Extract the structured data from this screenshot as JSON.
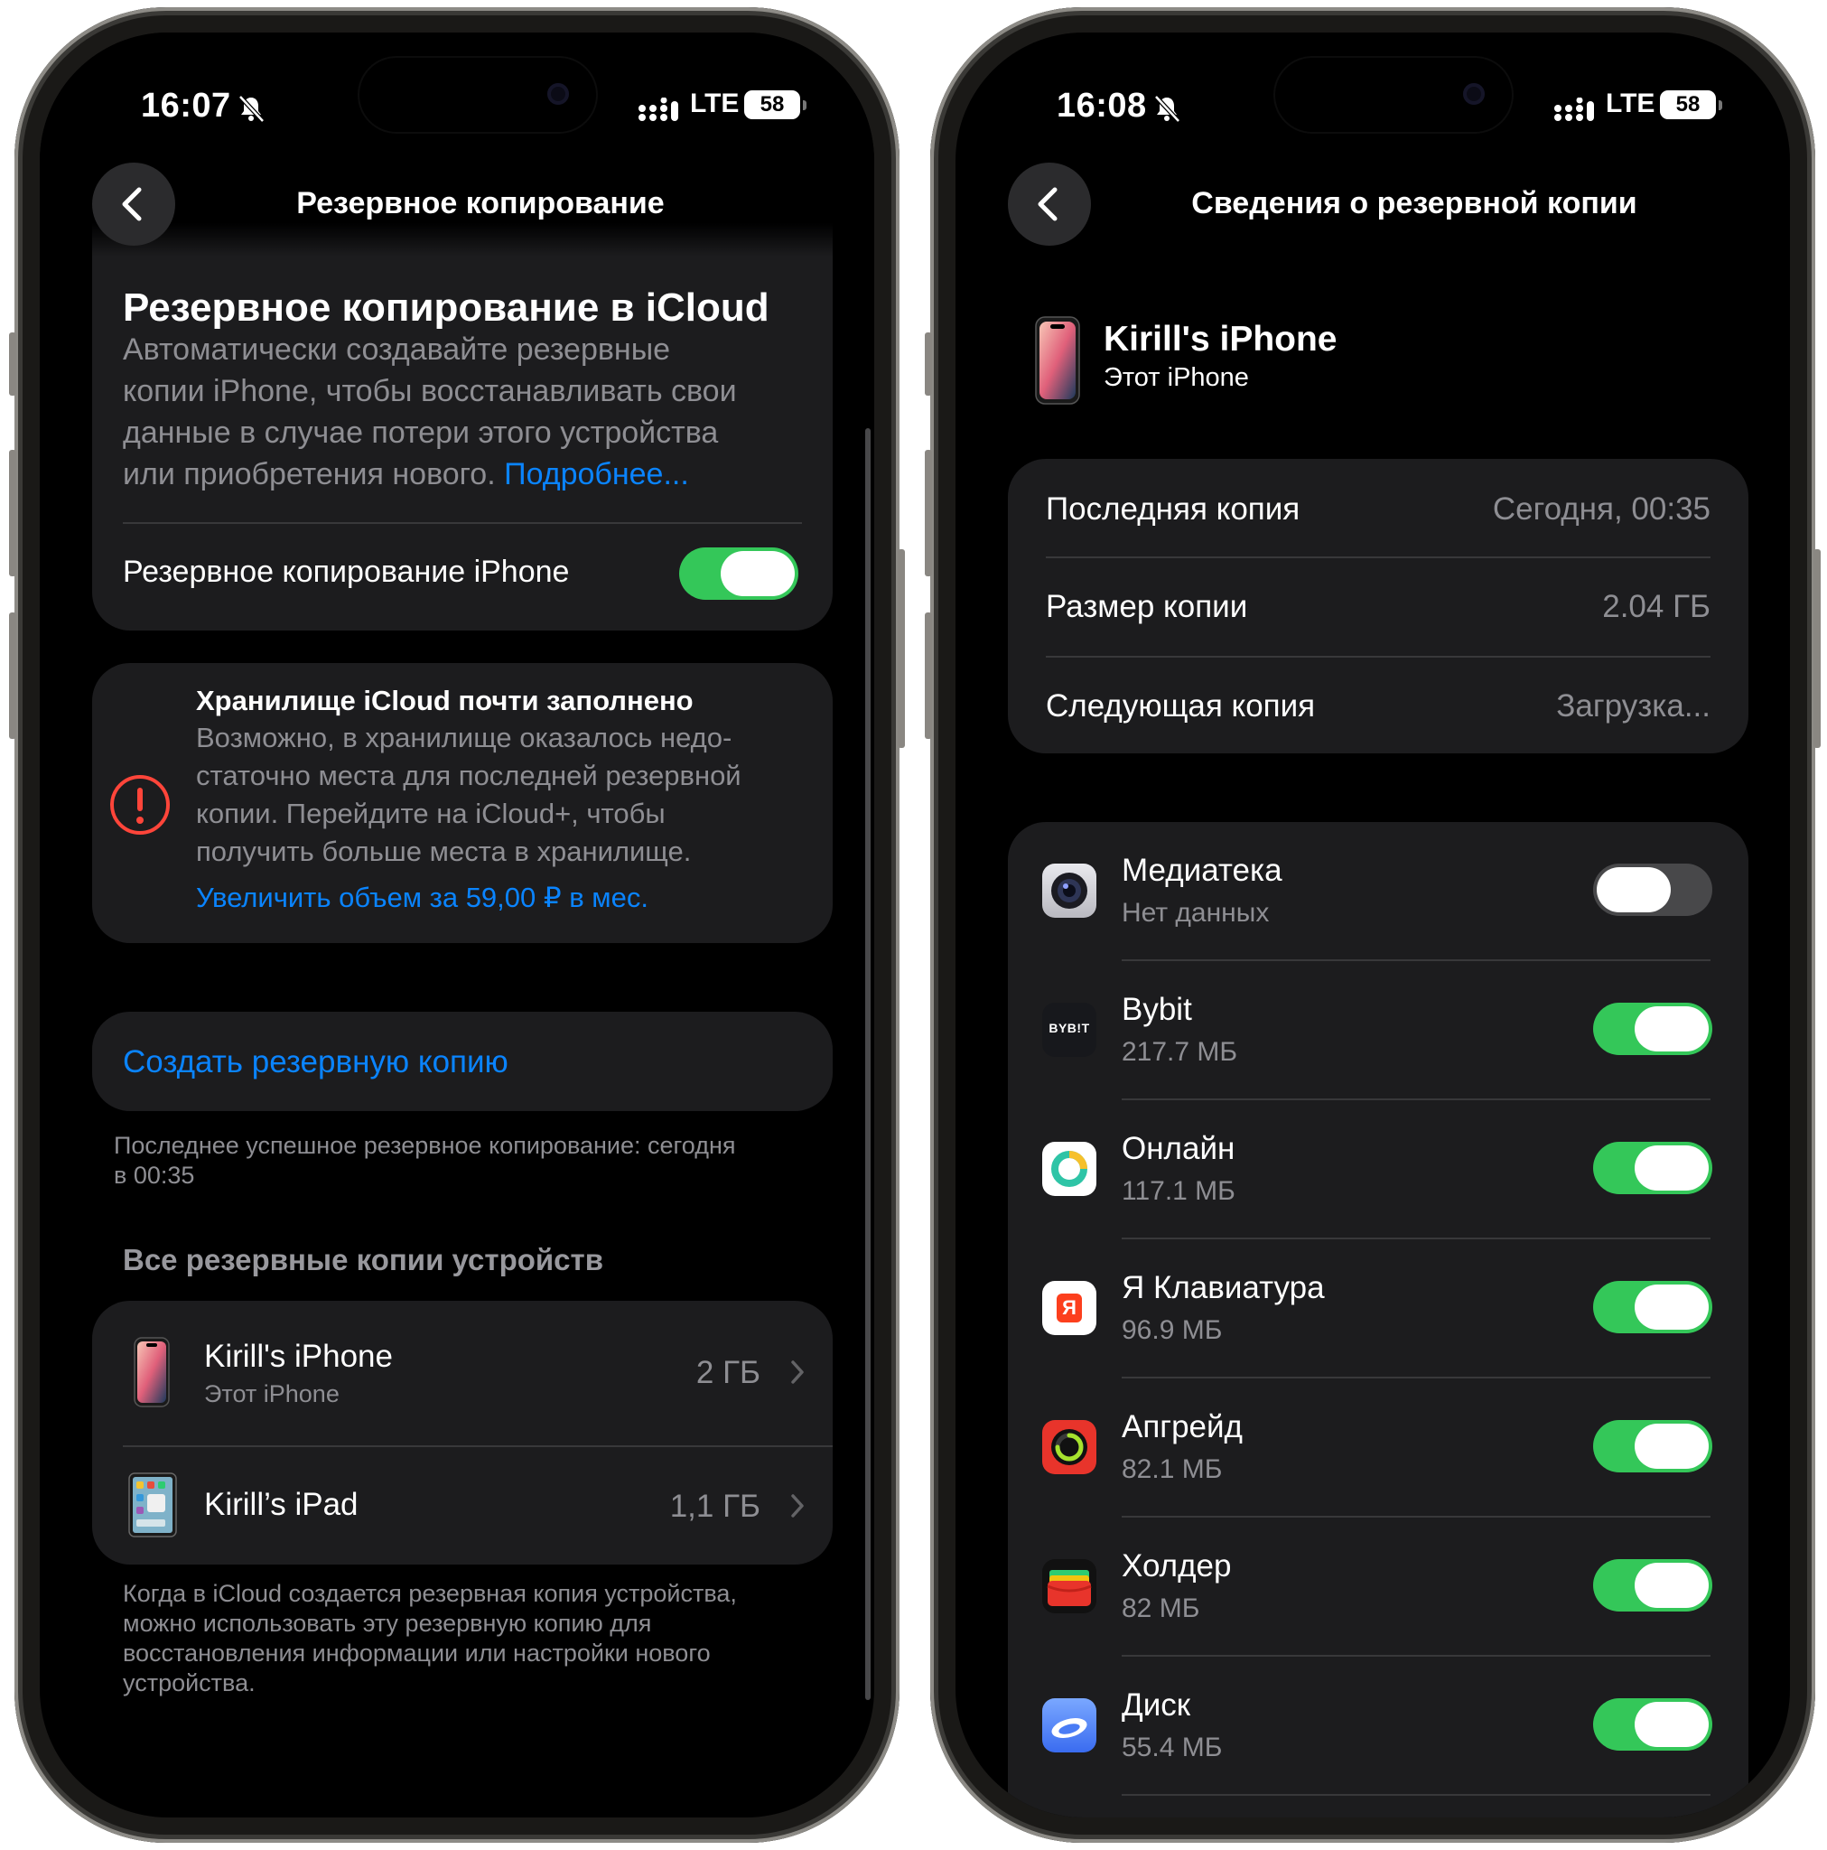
{
  "left": {
    "status": {
      "time": "16:07",
      "network": "LTE",
      "battery": "58"
    },
    "nav": {
      "title": "Резервное копирование"
    },
    "icloud_section": {
      "title": "Резервное копирование в iCloud",
      "desc_lines": [
        "Автоматически создавайте резервные",
        "копии iPhone, чтобы восстанавливать свои",
        "данные в случае потери этого устройства",
        "или приобретения нового."
      ],
      "more_link": "Подробнее...",
      "toggle_label": "Резервное копирование iPhone"
    },
    "warning": {
      "title": "Хранилище iCloud почти заполнено",
      "lines": [
        "Возможно, в хранилище оказалось недо-",
        "статочно места для последней резервной",
        "копии. Перейдите на iCloud+, чтобы",
        "получить больше места в хранилище."
      ],
      "link": "Увеличить объем за 59,00 ₽ в мес."
    },
    "backup_now": {
      "label": "Создать резервную копию",
      "last_lines": [
        "Последнее успешное резервное копирование: сегодня",
        "в 00:35"
      ]
    },
    "all_backups": {
      "header": "Все резервные копии устройств",
      "devices": [
        {
          "name": "Kirill's iPhone",
          "subtitle": "Этот iPhone",
          "size": "2 ГБ"
        },
        {
          "name": "Kirill’s iPad",
          "size": "1,1 ГБ"
        }
      ],
      "footer_lines": [
        "Когда в iCloud создается резервная копия устройства,",
        "можно использовать эту резервную копию для",
        "восстановления информации или настройки нового",
        "устройства."
      ]
    }
  },
  "right": {
    "status": {
      "time": "16:08",
      "network": "LTE",
      "battery": "58"
    },
    "nav": {
      "title": "Сведения о резервной копии"
    },
    "device": {
      "name": "Kirill's iPhone",
      "subtitle": "Этот iPhone"
    },
    "info_rows": [
      {
        "label": "Последняя копия",
        "value": "Сегодня, 00:35"
      },
      {
        "label": "Размер копии",
        "value": "2.04 ГБ"
      },
      {
        "label": "Следующая копия",
        "value": "Загрузка..."
      }
    ],
    "apps": [
      {
        "name": "Медиатека",
        "size": "Нет данных",
        "enabled": false,
        "icon": "camera-lens-icon"
      },
      {
        "name": "Bybit",
        "size": "217.7 МБ",
        "enabled": true,
        "icon": "bybit-icon",
        "icon_text": "BYB!T"
      },
      {
        "name": "Онлайн",
        "size": "117.1 МБ",
        "enabled": true,
        "icon": "ring-logo-icon"
      },
      {
        "name": "Я Клавиатура",
        "size": "96.9 МБ",
        "enabled": true,
        "icon": "yandex-keyboard-icon",
        "icon_text": "Я"
      },
      {
        "name": "Апгрейд",
        "size": "82.1 МБ",
        "enabled": true,
        "icon": "activity-ring-icon"
      },
      {
        "name": "Холдер",
        "size": "82 МБ",
        "enabled": true,
        "icon": "wallet-icon"
      },
      {
        "name": "Диск",
        "size": "55.4 МБ",
        "enabled": true,
        "icon": "cloud-disk-icon"
      }
    ]
  },
  "colors": {
    "accent": "#0a84ff",
    "toggle_on": "#34c759",
    "warning": "#ff453a",
    "card": "#1c1c1e"
  }
}
